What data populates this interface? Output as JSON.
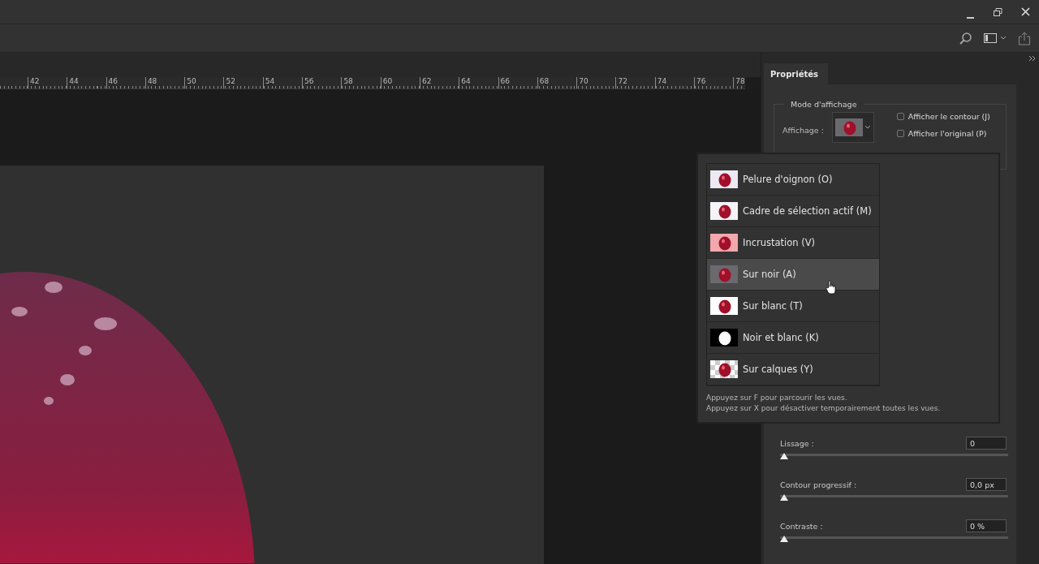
{
  "ruler": {
    "ticks": [
      "42",
      "44",
      "46",
      "48",
      "50",
      "52",
      "54",
      "56",
      "58",
      "60",
      "62",
      "64",
      "66",
      "68",
      "70",
      "72",
      "74",
      "76",
      "78"
    ]
  },
  "properties_panel": {
    "tab": {
      "label": "Propriétés",
      "selected": true
    },
    "display_mode": {
      "legend": "Mode d'affichage",
      "display_label": "Affichage :",
      "current_view": {
        "kind": "black"
      },
      "options": [
        {
          "label": "Afficher le contour (J)",
          "checked": false
        },
        {
          "label": "Afficher l'original (P)",
          "checked": false
        }
      ]
    },
    "adjustments": [
      {
        "label": "Lissage :",
        "value": "0",
        "level": 0
      },
      {
        "label": "Contour progressif :",
        "value": "0,0 px",
        "level": 0
      },
      {
        "label": "Contraste :",
        "value": "0 %",
        "level": 0
      }
    ]
  },
  "view_menu": {
    "items": [
      {
        "kind": "onion",
        "label": "Pelure d'oignon (O)",
        "selected": false
      },
      {
        "kind": "marquee",
        "label": "Cadre de sélection actif (M)",
        "selected": false
      },
      {
        "kind": "overlay",
        "label": "Incrustation (V)",
        "selected": false
      },
      {
        "kind": "black",
        "label": "Sur noir (A)",
        "selected": true
      },
      {
        "kind": "white",
        "label": "Sur blanc (T)",
        "selected": false
      },
      {
        "kind": "bw",
        "label": "Noir et blanc (K)",
        "selected": false
      },
      {
        "kind": "layers",
        "label": "Sur calques (Y)",
        "selected": false
      }
    ],
    "hints": [
      "Appuyez sur F pour parcourir les vues.",
      "Appuyez sur X pour désactiver temporairement toutes les vues."
    ]
  }
}
